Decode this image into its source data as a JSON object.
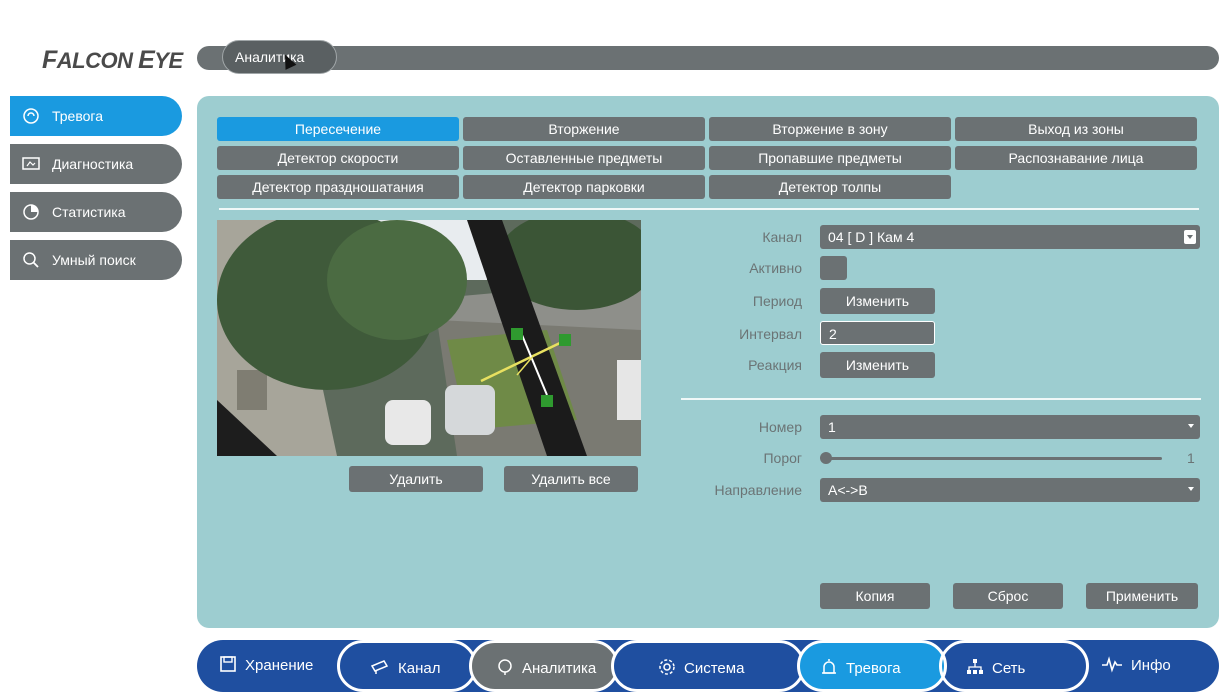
{
  "logo": {
    "text": "Falcon Eye"
  },
  "header": {
    "active_tab": "Аналитика"
  },
  "sidebar": {
    "items": [
      {
        "label": "Тревога",
        "icon": "alarm-icon",
        "active": true
      },
      {
        "label": "Диагностика",
        "icon": "monitor-icon",
        "active": false
      },
      {
        "label": "Статистика",
        "icon": "pie-chart-icon",
        "active": false
      },
      {
        "label": "Умный поиск",
        "icon": "search-icon",
        "active": false
      }
    ]
  },
  "tabs": [
    {
      "label": "Пересечение",
      "active": true
    },
    {
      "label": "Вторжение"
    },
    {
      "label": "Вторжение в зону"
    },
    {
      "label": "Выход из зоны"
    },
    {
      "label": "Детектор скорости"
    },
    {
      "label": "Оставленные предметы"
    },
    {
      "label": "Пропавшие предметы"
    },
    {
      "label": "Распознавание лица"
    },
    {
      "label": "Детектор праздношатания"
    },
    {
      "label": "Детектор парковки"
    },
    {
      "label": "Детектор толпы"
    }
  ],
  "video": {
    "delete_label": "Удалить",
    "delete_all_label": "Удалить все"
  },
  "form": {
    "channel_label": "Канал",
    "channel_value": "04 [ D ] Кам 4",
    "active_label": "Активно",
    "period_label": "Период",
    "period_button": "Изменить",
    "interval_label": "Интервал",
    "interval_value": "2",
    "reaction_label": "Реакция",
    "reaction_button": "Изменить",
    "number_label": "Номер",
    "number_value": "1",
    "threshold_label": "Порог",
    "threshold_value": "1",
    "direction_label": "Направление",
    "direction_value": "A<->B"
  },
  "actions": {
    "copy": "Копия",
    "reset": "Сброс",
    "apply": "Применить"
  },
  "bottom_nav": [
    {
      "label": "Хранение",
      "icon": "save-icon"
    },
    {
      "label": "Канал",
      "icon": "camera-icon"
    },
    {
      "label": "Аналитика",
      "icon": "head-icon"
    },
    {
      "label": "Система",
      "icon": "gear-icon"
    },
    {
      "label": "Тревога",
      "icon": "alarm-icon"
    },
    {
      "label": "Сеть",
      "icon": "network-icon"
    },
    {
      "label": "Инфо",
      "icon": "pulse-icon"
    }
  ],
  "colors": {
    "accent": "#1a9ae0",
    "panel": "#9dcdd0",
    "button": "#6b7173",
    "nav": "#1f4fa0"
  }
}
